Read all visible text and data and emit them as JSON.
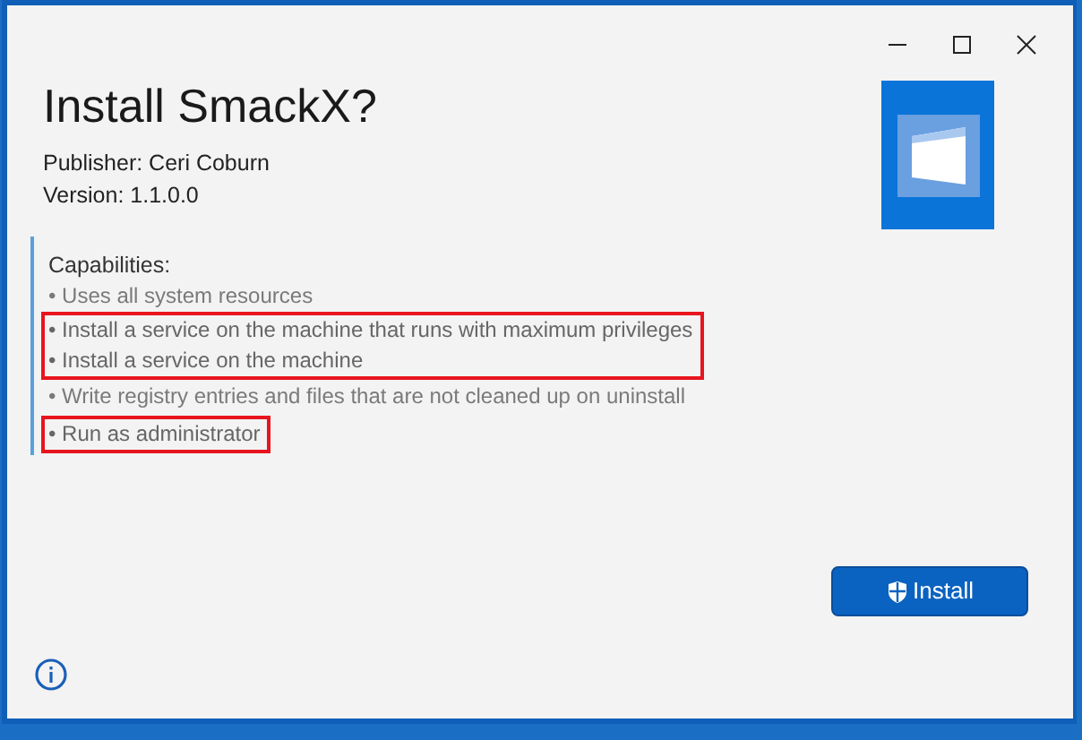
{
  "title": "Install SmackX?",
  "publisher": "Publisher: Ceri Coburn",
  "version": "Version: 1.1.0.0",
  "capabilities_heading": "Capabilities:",
  "capabilities": [
    {
      "text": "• Uses all system resources",
      "highlighted": false
    },
    {
      "text": "• Install a service on the machine that runs with maximum privileges",
      "highlighted": true
    },
    {
      "text": "• Install a service on the machine",
      "highlighted": true
    },
    {
      "text": "• Write registry entries and files that are not cleaned up on uninstall",
      "highlighted": false
    },
    {
      "text": "• Run as administrator",
      "highlighted": true
    }
  ],
  "install_button": "Install"
}
